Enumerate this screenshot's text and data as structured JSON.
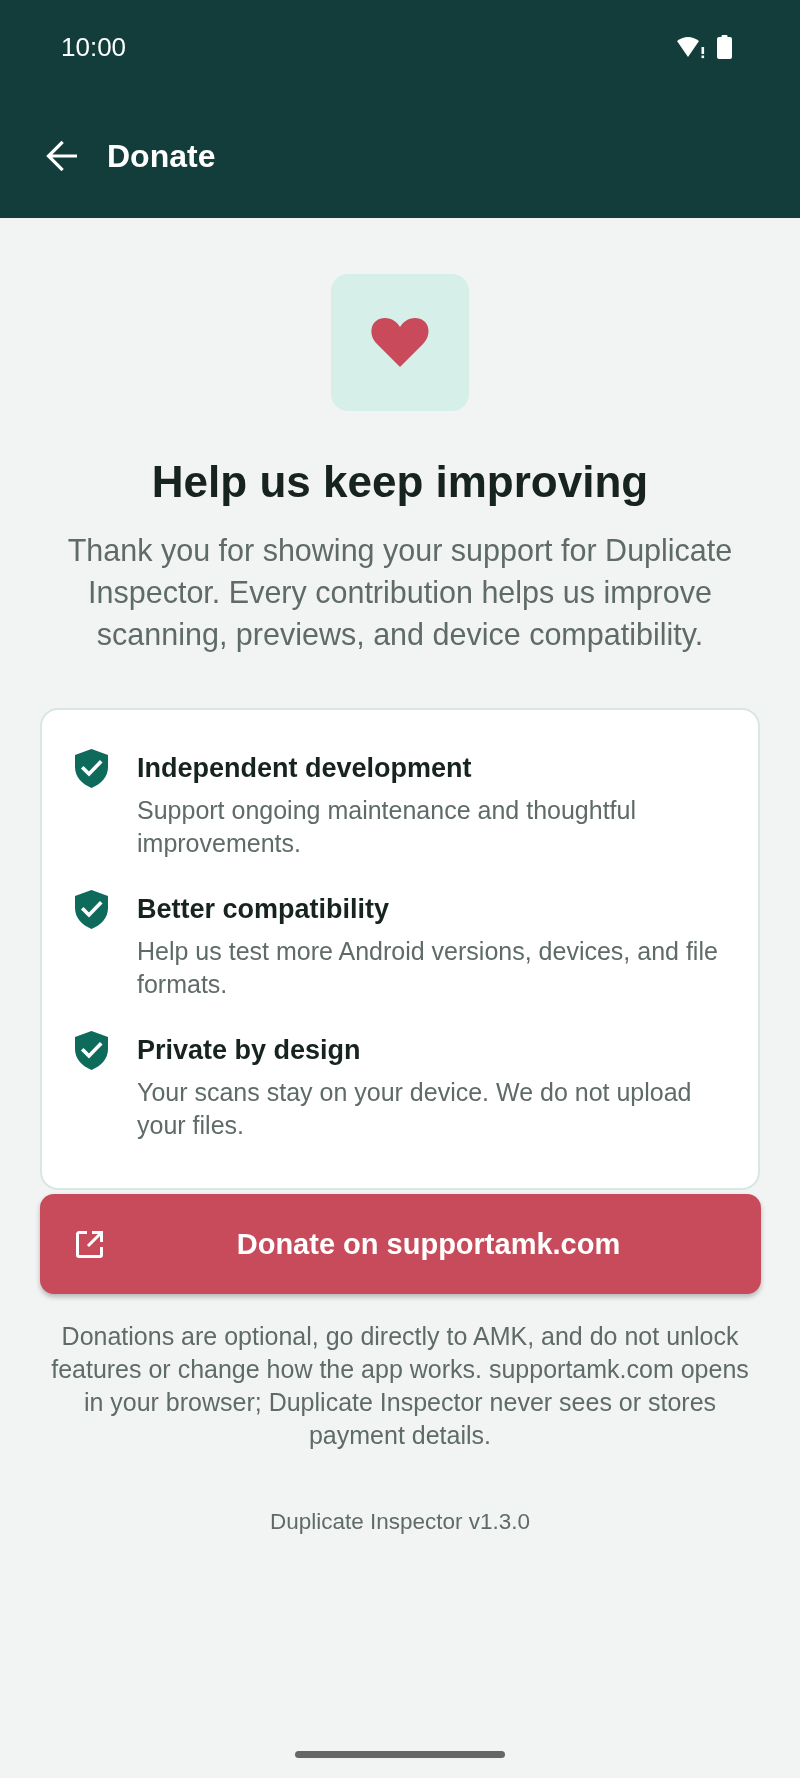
{
  "status_bar": {
    "time": "10:00"
  },
  "app_bar": {
    "title": "Donate"
  },
  "hero": {
    "title": "Help us keep improving",
    "description": "Thank you for showing your support for Duplicate Inspector. Every contribution helps us improve scanning, previews, and device compatibility."
  },
  "benefits": [
    {
      "title": "Independent development",
      "description": "Support ongoing maintenance and thoughtful improvements."
    },
    {
      "title": "Better compatibility",
      "description": "Help us test more Android versions, devices, and file formats."
    },
    {
      "title": "Private by design",
      "description": "Your scans stay on your device. We do not upload your files."
    }
  ],
  "donate_button": {
    "label": "Donate on supportamk.com"
  },
  "disclaimer": "Donations are optional, go directly to AMK, and do not unlock features or change how the app works. supportamk.com opens in your browser; Duplicate Inspector never sees or stores payment details.",
  "version": "Duplicate Inspector v1.3.0"
}
